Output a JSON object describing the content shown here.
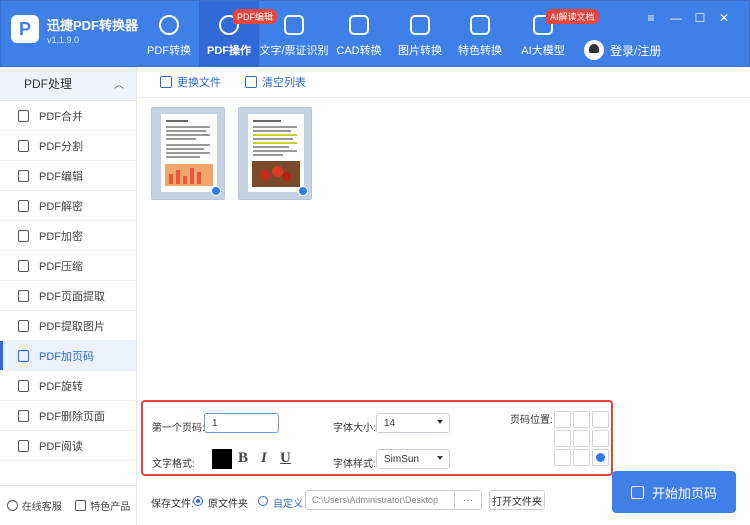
{
  "app": {
    "logo_letter": "P",
    "name": "迅捷PDF转换器",
    "version": "v1.1.9.0"
  },
  "nav": {
    "items": [
      {
        "label": "PDF转换",
        "icon": "refresh-doc-icon"
      },
      {
        "label": "PDF操作",
        "icon": "gear-doc-icon",
        "badge": "PDF编辑"
      },
      {
        "label": "文字/票证识别",
        "icon": "scan-icon"
      },
      {
        "label": "CAD转换",
        "icon": "cad-icon"
      },
      {
        "label": "图片转换",
        "icon": "image-icon"
      },
      {
        "label": "特色转换",
        "icon": "star-doc-icon"
      },
      {
        "label": "AI大模型",
        "icon": "ai-icon",
        "badge": "AI解读文档"
      }
    ]
  },
  "window": {
    "menu": "≡",
    "minimize": "—",
    "maximize": "☐",
    "close": "✕"
  },
  "user": {
    "login": "登录/注册"
  },
  "sidebar": {
    "header": "PDF处理",
    "items": [
      {
        "label": "PDF合并"
      },
      {
        "label": "PDF分割"
      },
      {
        "label": "PDF编辑"
      },
      {
        "label": "PDF解密"
      },
      {
        "label": "PDF加密"
      },
      {
        "label": "PDF压缩"
      },
      {
        "label": "PDF页面提取"
      },
      {
        "label": "PDF提取图片"
      },
      {
        "label": "PDF加页码"
      },
      {
        "label": "PDF旋转"
      },
      {
        "label": "PDF删除页面"
      },
      {
        "label": "PDF阅读"
      }
    ],
    "active": "PDF加页码",
    "footer": {
      "service": "在线客服",
      "products": "特色产品"
    }
  },
  "toolbar": {
    "replace": "更换文件",
    "clear": "清空列表"
  },
  "settings": {
    "first_page_label": "第一个页码:",
    "first_page_value": "1",
    "font_size_label": "字体大小:",
    "font_size_value": "14",
    "position_label": "页码位置:",
    "text_style_label": "文字格式:",
    "text_color": "#000000",
    "bold": "B",
    "italic": "I",
    "underline": "U",
    "font_family_label": "字体样式:",
    "font_family_value": "SimSun",
    "selected_position": "bottom-right"
  },
  "output": {
    "save_label": "保存文件:",
    "option_source": "原文件夹",
    "option_custom": "自定义",
    "selected": "原文件夹",
    "path": "C:\\Users\\Administrator\\Desktop",
    "browse": "···",
    "open_folder": "打开文件夹"
  },
  "start_button": "开始加页码",
  "colors": {
    "brand": "#3f7fe8",
    "highlight": "#e5453a",
    "badge": "#e8453c"
  }
}
